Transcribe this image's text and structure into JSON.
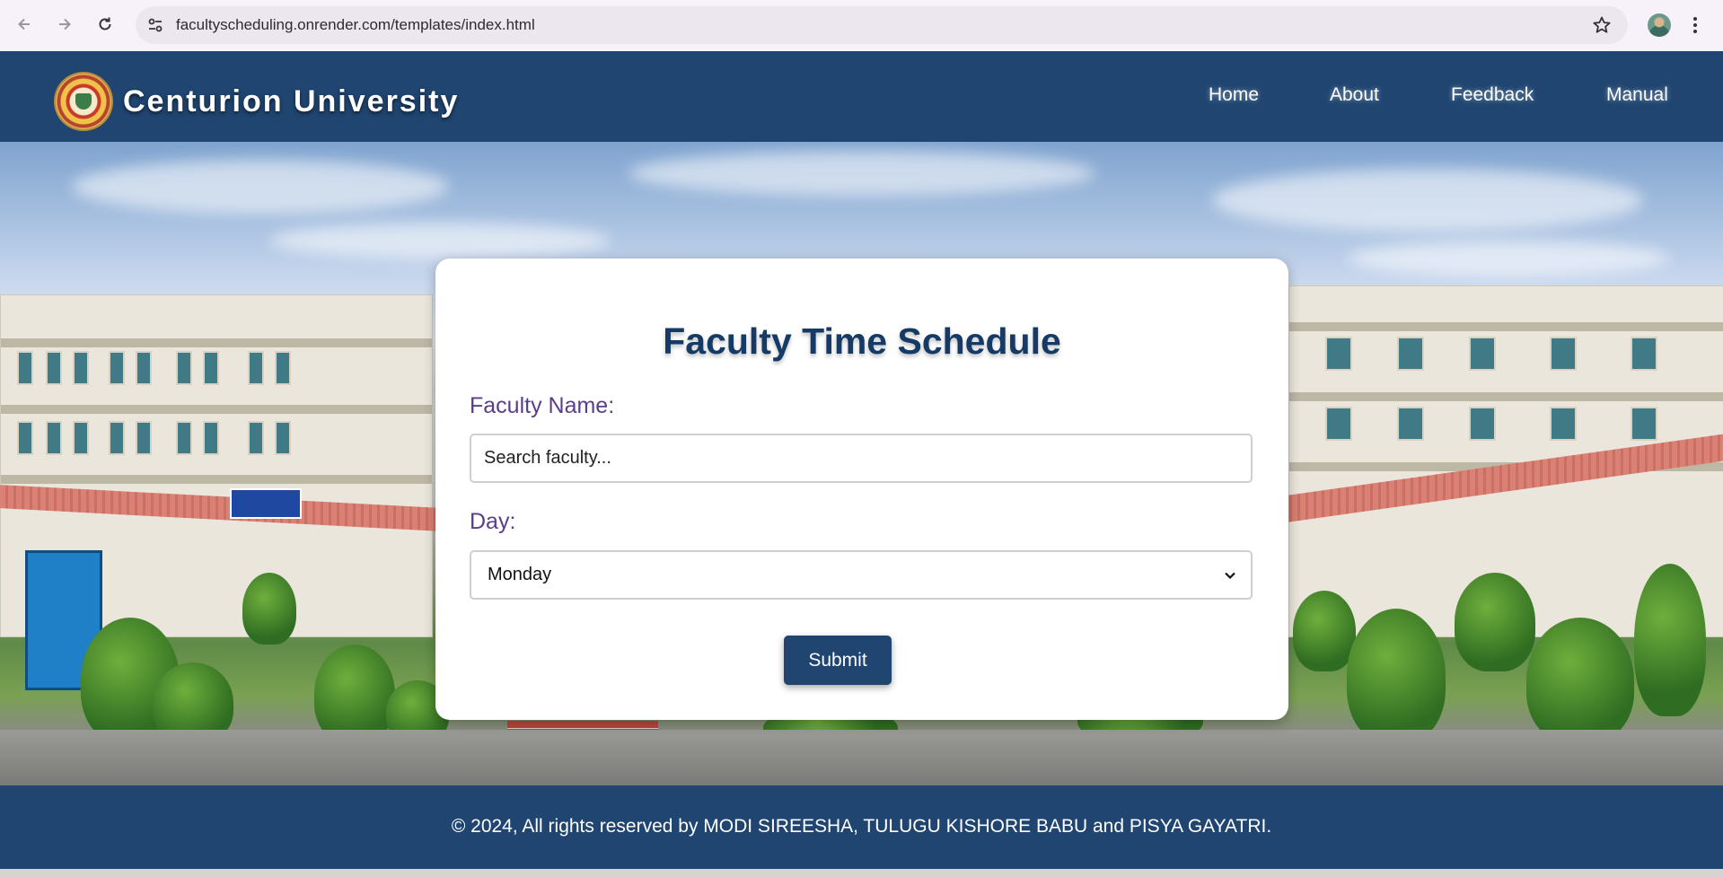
{
  "browser": {
    "url": "facultyscheduling.onrender.com/templates/index.html"
  },
  "header": {
    "brand": "Centurion University",
    "nav": [
      {
        "label": "Home"
      },
      {
        "label": "About"
      },
      {
        "label": "Feedback"
      },
      {
        "label": "Manual"
      }
    ]
  },
  "form": {
    "title": "Faculty Time Schedule",
    "faculty_label": "Faculty Name:",
    "faculty_placeholder": "Search faculty...",
    "faculty_value": "",
    "day_label": "Day:",
    "day_selected": "Monday",
    "submit_label": "Submit"
  },
  "footer": {
    "text": "© 2024, All rights reserved by MODI SIREESHA, TULUGU KISHORE BABU and PISYA GAYATRI."
  },
  "colors": {
    "primary": "#1f4570",
    "title": "#163a66",
    "label": "#5a3e8a"
  },
  "icons": [
    "back-arrow-icon",
    "forward-arrow-icon",
    "reload-icon",
    "site-settings-icon",
    "bookmark-star-icon",
    "profile-avatar",
    "menu-kebab-icon",
    "university-logo",
    "chevron-down-icon"
  ]
}
